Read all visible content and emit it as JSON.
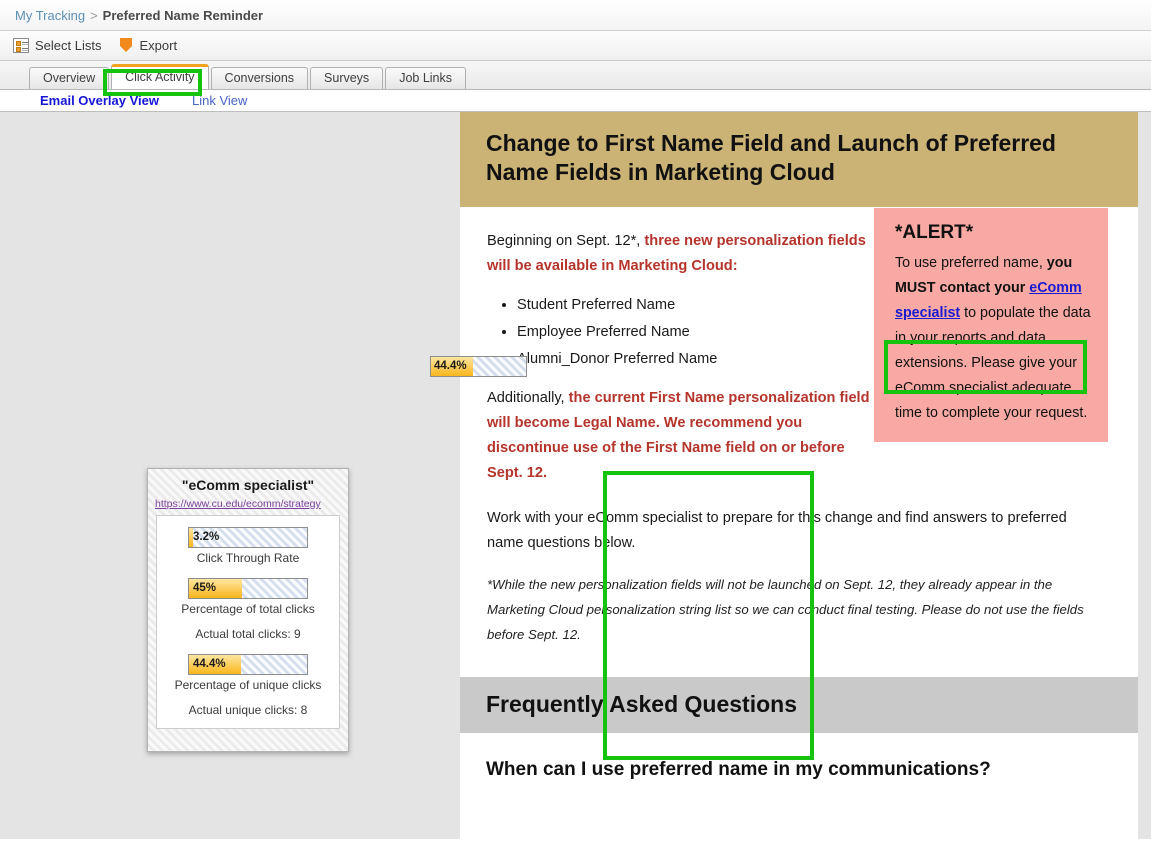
{
  "breadcrumb": {
    "parent": "My Tracking",
    "separator": ">",
    "current": "Preferred Name Reminder"
  },
  "toolbar": {
    "select_lists_label": "Select Lists",
    "export_label": "Export",
    "icons": [
      "select-lists-icon",
      "export-icon"
    ]
  },
  "tabs": [
    {
      "label": "Overview",
      "active": false
    },
    {
      "label": "Click Activity",
      "active": true
    },
    {
      "label": "Conversions",
      "active": false
    },
    {
      "label": "Surveys",
      "active": false
    },
    {
      "label": "Job Links",
      "active": false
    }
  ],
  "subnav": [
    {
      "label": "Email Overlay View",
      "active": true
    },
    {
      "label": "Link View",
      "active": false
    }
  ],
  "email": {
    "header_title": "Change to First Name Field and Launch of Preferred Name Fields in Marketing Cloud",
    "intro_plain": "Beginning on Sept. 12*, ",
    "intro_red": "three new personalization fields will be available in Marketing Cloud",
    "intro_tail": ":",
    "bullets": [
      "Student Preferred Name",
      "Employee Preferred Name",
      "Alumni_Donor Preferred Name"
    ],
    "para2_plain": "Additionally, ",
    "para2_red": "the current First Name personalization field will become Legal Name. We recommend you discontinue use of the First Name field on or before Sept. 12.",
    "para3": "Work with your eComm specialist to prepare for this change and find answers to preferred name questions below.",
    "footnote": "*While the new personalization fields will not be launched on Sept. 12, they already appear in the Marketing Cloud personalization string list so we can conduct final testing. Please do not use the fields before Sept. 12.",
    "alert": {
      "title": "*ALERT*",
      "line1": "To use preferred name, ",
      "bold1": "you MUST contact your ",
      "link": "eComm specialist",
      "tail": " to populate the data in your reports and data extensions. Please give your eComm specialist adequate time to complete your request."
    },
    "faq_heading": "Frequently Asked Questions",
    "faq_question": "When can I use preferred name in my communications?"
  },
  "overlay_inline": {
    "percent_label": "44.4%",
    "percent_value": 44.4
  },
  "popup": {
    "title": "\"eComm specialist\"",
    "url": "https://www.cu.edu/ecomm/strategy",
    "metrics": [
      {
        "value_label": "3.2%",
        "value": 3.2,
        "label": "Click Through Rate"
      },
      {
        "value_label": "45%",
        "value": 45,
        "label": "Percentage of total clicks",
        "sub": "Actual total clicks: 9"
      },
      {
        "value_label": "44.4%",
        "value": 44.4,
        "label": "Percentage of unique clicks",
        "sub": "Actual unique clicks: 8"
      }
    ]
  },
  "colors": {
    "accent_orange": "#f2a31c",
    "header_gold": "#cbb275",
    "alert_pink": "#f8a9a3",
    "red_text": "#b5342b",
    "highlight_green": "#16c40f",
    "faq_gray": "#c9c9c9"
  }
}
